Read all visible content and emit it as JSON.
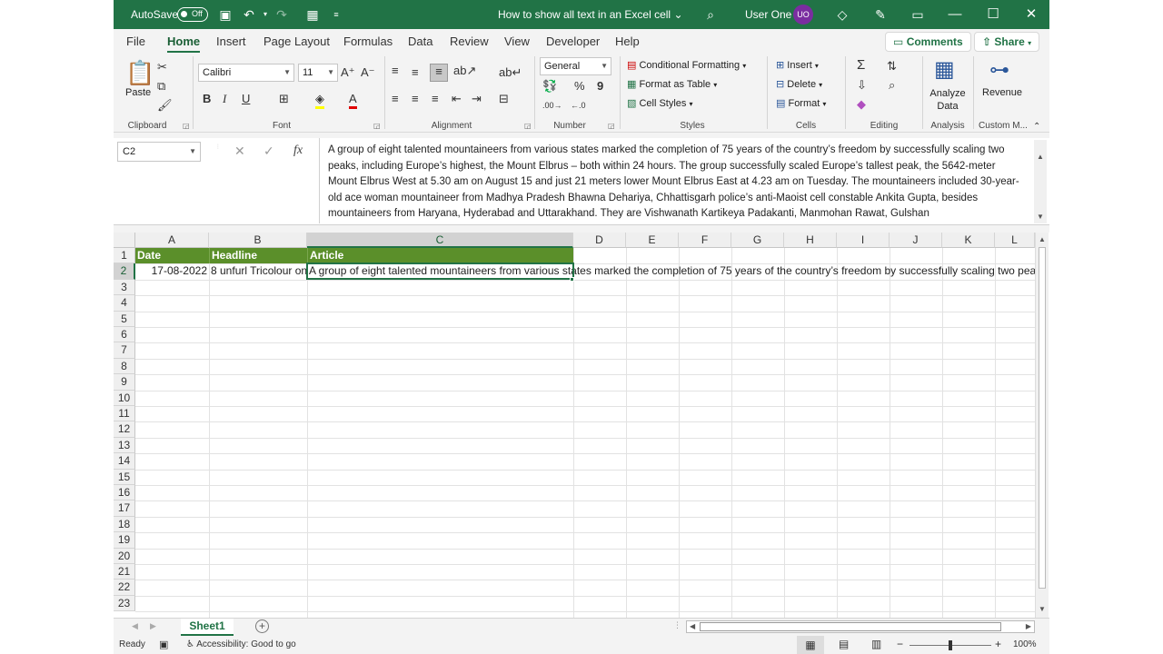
{
  "titlebar": {
    "autosave": "AutoSave",
    "toggle": "Off",
    "doc_title": "How to show all text in an Excel cell",
    "user": "User One",
    "initials": "UO"
  },
  "tabs": [
    "File",
    "Home",
    "Insert",
    "Page Layout",
    "Formulas",
    "Data",
    "Review",
    "View",
    "Developer",
    "Help"
  ],
  "comments_label": "Comments",
  "share_label": "Share",
  "ribbon": {
    "paste": "Paste",
    "clipboard": "Clipboard",
    "font_name": "Calibri",
    "font_size": "11",
    "font": "Font",
    "alignment": "Alignment",
    "number_format": "General",
    "number": "Number",
    "conditional": "Conditional Formatting",
    "format_table": "Format as Table",
    "cell_styles": "Cell Styles",
    "styles": "Styles",
    "insert": "Insert",
    "delete": "Delete",
    "format": "Format",
    "cells": "Cells",
    "editing": "Editing",
    "analyze_data": "Analyze Data",
    "analysis": "Analysis",
    "revenue": "Revenue",
    "custom": "Custom M..."
  },
  "formula_bar": {
    "name_box": "C2",
    "fx": "fx",
    "content": "A group of eight talented mountaineers from various states marked the completion of 75 years of the country’s freedom by successfully scaling two peaks, including Europe’s highest, the Mount Elbrus – both within 24 hours. The group successfully scaled Europe’s tallest peak, the 5642-meter Mount Elbrus West at 5.30 am on August 15 and just 21 meters lower Mount Elbrus East at 4.23 am on Tuesday. The mountaineers included 30-year-old ace woman mountaineer from Madhya Pradesh Bhawna Dehariya, Chhattisgarh police’s anti-Maoist cell constable Ankita Gupta, besides mountaineers from Haryana, Hyderabad and Uttarakhand. They are Vishwanath Kartikeya Padakanti, Manmohan Rawat, Gulshan"
  },
  "columns": [
    "A",
    "B",
    "C",
    "D",
    "E",
    "F",
    "G",
    "H",
    "I",
    "J",
    "K",
    "L"
  ],
  "rows": [
    "1",
    "2",
    "3",
    "4",
    "5",
    "6",
    "7",
    "8",
    "9",
    "10",
    "11",
    "12",
    "13",
    "14",
    "15",
    "16",
    "17",
    "18",
    "19",
    "20",
    "21",
    "22",
    "23"
  ],
  "cells": {
    "header": {
      "a": "Date",
      "b": "Headline",
      "c": "Article"
    },
    "row2": {
      "a": "17-08-2022",
      "b": "8 unfurl Tricolour on",
      "c": "A group of eight talented mountaineers from various states marked the completion of 75 years of the country’s freedom by successfully scaling two peaks"
    }
  },
  "sheet": {
    "name": "Sheet1"
  },
  "status": {
    "ready": "Ready",
    "accessibility": "Accessibility: Good to go",
    "zoom": "100%"
  }
}
